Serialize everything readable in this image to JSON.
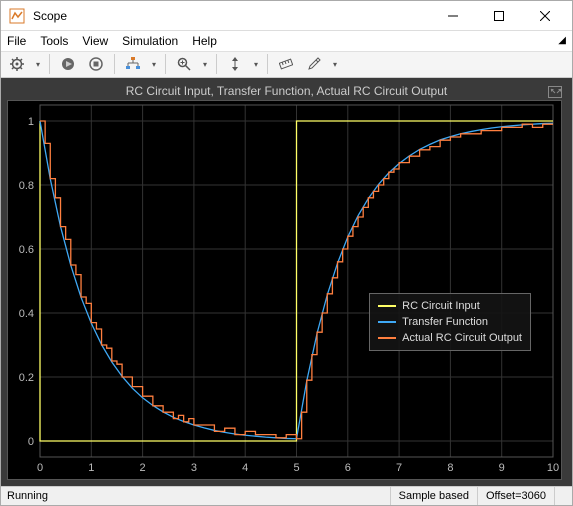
{
  "window": {
    "title": "Scope"
  },
  "menu": {
    "items": [
      "File",
      "Tools",
      "View",
      "Simulation",
      "Help"
    ]
  },
  "toolbar_icons": {
    "gear": "gear-icon",
    "record": "record-icon",
    "stop": "stop-icon",
    "hierarchy": "hierarchy-icon",
    "zoom": "zoom-icon",
    "autoscale": "autoscale-icon",
    "measure": "measure-icon",
    "edit": "edit-icon"
  },
  "status": {
    "state": "Running",
    "sample": "Sample based",
    "offset": "Offset=3060"
  },
  "chart_data": {
    "type": "line",
    "title": "RC Circuit Input, Transfer Function, Actual RC Circuit Output",
    "xlabel": "",
    "ylabel": "",
    "xlim": [
      0,
      10
    ],
    "ylim": [
      -0.05,
      1.05
    ],
    "xticks": [
      0,
      1,
      2,
      3,
      4,
      5,
      6,
      7,
      8,
      9,
      10
    ],
    "yticks": [
      0,
      0.2,
      0.4,
      0.6,
      0.8,
      1
    ],
    "legend_position": "right-middle",
    "series": [
      {
        "name": "RC Circuit Input",
        "color": "#ffff66",
        "x": [
          0,
          0.0001,
          5,
          5.0001,
          10
        ],
        "y": [
          1,
          0,
          0,
          1,
          1
        ]
      },
      {
        "name": "Transfer Function",
        "color": "#3fa9f5",
        "x": [
          0,
          0.2,
          0.4,
          0.6,
          0.8,
          1,
          1.2,
          1.4,
          1.6,
          1.8,
          2,
          2.2,
          2.4,
          2.6,
          2.8,
          3,
          3.2,
          3.4,
          3.6,
          3.8,
          4,
          4.2,
          4.4,
          4.6,
          4.8,
          5,
          5.2,
          5.4,
          5.6,
          5.8,
          6,
          6.2,
          6.4,
          6.6,
          6.8,
          7,
          7.2,
          7.4,
          7.6,
          7.8,
          8,
          8.2,
          8.4,
          8.6,
          8.8,
          9,
          9.2,
          9.4,
          9.6,
          9.8,
          10
        ],
        "y": [
          1,
          0.819,
          0.67,
          0.549,
          0.449,
          0.368,
          0.301,
          0.247,
          0.202,
          0.165,
          0.135,
          0.111,
          0.091,
          0.074,
          0.061,
          0.05,
          0.041,
          0.033,
          0.027,
          0.022,
          0.018,
          0.015,
          0.012,
          0.01,
          0.008,
          0.007,
          0.188,
          0.336,
          0.457,
          0.556,
          0.638,
          0.704,
          0.758,
          0.802,
          0.838,
          0.867,
          0.891,
          0.911,
          0.927,
          0.941,
          0.951,
          0.96,
          0.967,
          0.973,
          0.978,
          0.982,
          0.985,
          0.988,
          0.99,
          0.992,
          0.993
        ]
      },
      {
        "name": "Actual RC Circuit Output",
        "color": "#ff7f3f",
        "x": [
          0,
          0.1,
          0.2,
          0.3,
          0.4,
          0.5,
          0.6,
          0.7,
          0.8,
          0.9,
          1,
          1.1,
          1.2,
          1.3,
          1.4,
          1.5,
          1.6,
          1.7,
          1.8,
          1.9,
          2,
          2.1,
          2.2,
          2.3,
          2.4,
          2.5,
          2.6,
          2.7,
          2.8,
          2.9,
          3,
          3.2,
          3.4,
          3.6,
          3.8,
          4,
          4.2,
          4.4,
          4.6,
          4.8,
          5,
          5.1,
          5.2,
          5.3,
          5.4,
          5.5,
          5.6,
          5.7,
          5.8,
          5.9,
          6,
          6.1,
          6.2,
          6.3,
          6.4,
          6.5,
          6.6,
          6.7,
          6.8,
          6.9,
          7,
          7.2,
          7.4,
          7.6,
          7.8,
          8,
          8.2,
          8.4,
          8.6,
          8.8,
          9,
          9.2,
          9.4,
          9.6,
          9.8,
          10
        ],
        "y": [
          1,
          0.93,
          0.82,
          0.76,
          0.67,
          0.63,
          0.55,
          0.52,
          0.45,
          0.43,
          0.37,
          0.35,
          0.3,
          0.29,
          0.25,
          0.24,
          0.2,
          0.2,
          0.17,
          0.17,
          0.14,
          0.14,
          0.11,
          0.11,
          0.09,
          0.09,
          0.07,
          0.08,
          0.06,
          0.07,
          0.05,
          0.05,
          0.03,
          0.04,
          0.02,
          0.03,
          0.02,
          0.02,
          0.01,
          0.02,
          0.007,
          0.09,
          0.19,
          0.27,
          0.34,
          0.4,
          0.46,
          0.51,
          0.56,
          0.6,
          0.64,
          0.67,
          0.7,
          0.73,
          0.76,
          0.78,
          0.8,
          0.82,
          0.84,
          0.85,
          0.87,
          0.89,
          0.91,
          0.92,
          0.94,
          0.95,
          0.96,
          0.96,
          0.97,
          0.97,
          0.98,
          0.98,
          0.99,
          0.98,
          0.99,
          0.99
        ]
      }
    ]
  }
}
